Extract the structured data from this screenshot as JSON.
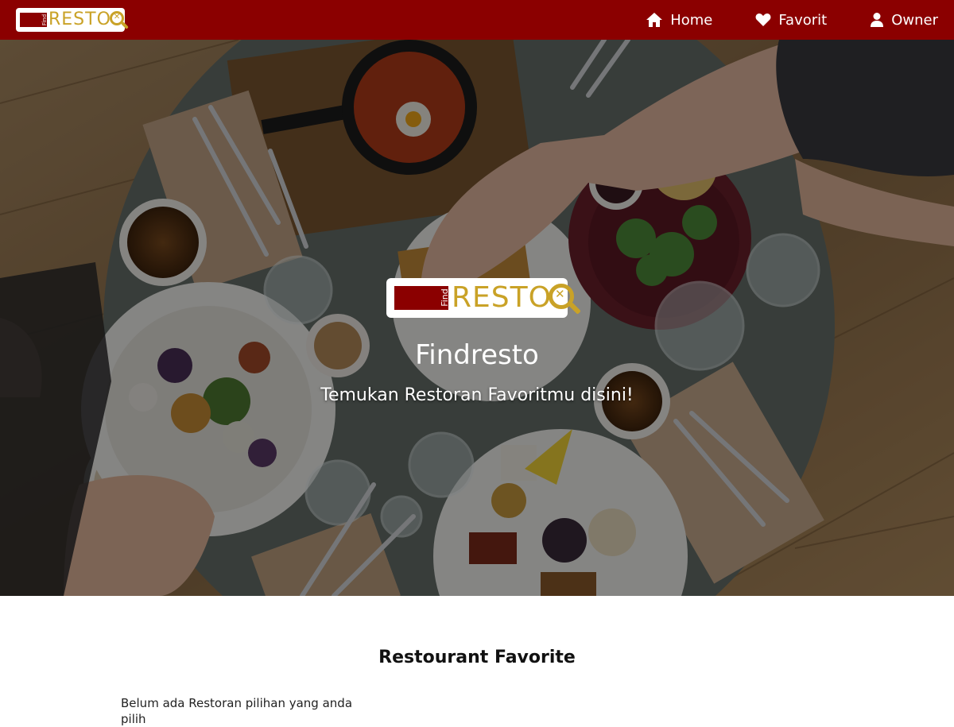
{
  "brand": {
    "logo_small_word": "Find",
    "logo_word": "RESTO",
    "name": "Findresto"
  },
  "nav": {
    "items": [
      {
        "label": "Home",
        "icon": "home-icon"
      },
      {
        "label": "Favorit",
        "icon": "heart-icon"
      },
      {
        "label": "Owner",
        "icon": "user-icon"
      }
    ]
  },
  "hero": {
    "title": "Findresto",
    "subtitle": "Temukan Restoran Favoritmu disini!"
  },
  "main": {
    "section_title": "Restourant Favorite",
    "empty_message": "Belum ada Restoran pilihan yang anda pilih"
  },
  "colors": {
    "primary": "#8b0000",
    "logo_gold": "#c9a227",
    "text_white": "#ffffff"
  }
}
